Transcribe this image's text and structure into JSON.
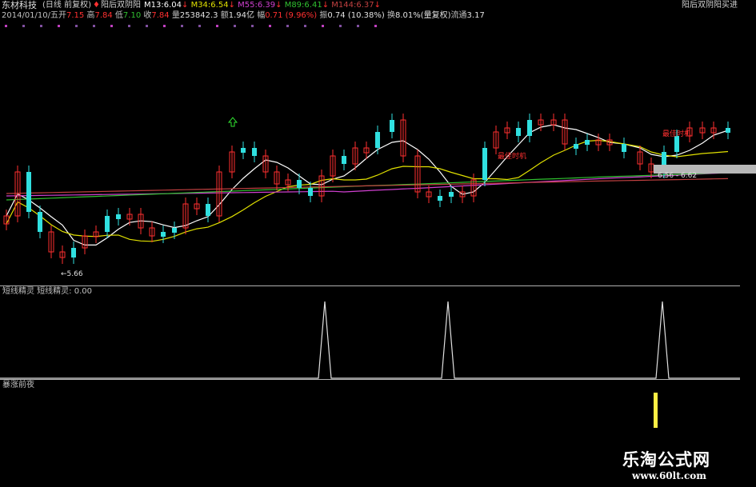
{
  "header": {
    "stock_name": "东材科技",
    "period": "(日线 前复权)",
    "indicator_label": "阳后双阴阳",
    "ma": [
      {
        "label": "M13:",
        "value": "6.04",
        "color": "#ffffff"
      },
      {
        "label": "M34:",
        "value": "6.54",
        "color": "#e0e000"
      },
      {
        "label": "M55:",
        "value": "6.39",
        "color": "#d040d0"
      },
      {
        "label": "M89:",
        "value": "6.41",
        "color": "#30c030"
      },
      {
        "label": "M144:",
        "value": "6.37",
        "color": "#c04040"
      }
    ],
    "right_label": "阳后双阴阳买进"
  },
  "quote": {
    "date": "2014/01/10/五",
    "open_label": "开",
    "open": "7.15",
    "high_label": "高",
    "high": "7.84",
    "low_label": "低",
    "low": "7.10",
    "close_label": "收",
    "close": "7.84",
    "volume_label": "量",
    "volume": "253842.3",
    "amount_label": "额",
    "amount": "1.94亿",
    "change_label": "幅",
    "change": "0.71 (9.96%)",
    "amplitude_label": "振",
    "amplitude": "0.74 (10.38%)",
    "turnover_label": "换",
    "turnover": "8.01%(量复权)",
    "float_label": "流通",
    "float": "3.17"
  },
  "main_chart": {
    "low_marker": "5.66",
    "price_range": "6.56 - 6.62",
    "signal_label": "最佳时机"
  },
  "panel2": {
    "title": "短线精灵",
    "label": "短线精灵:",
    "value": "0.00"
  },
  "panel3": {
    "title": "暴涨前夜"
  },
  "watermark": {
    "title": "乐淘公式网",
    "url": "www.60lt.com"
  },
  "colors": {
    "up": "#ff3030",
    "down": "#30e0e0",
    "signal_bar": "#ffee44"
  }
}
